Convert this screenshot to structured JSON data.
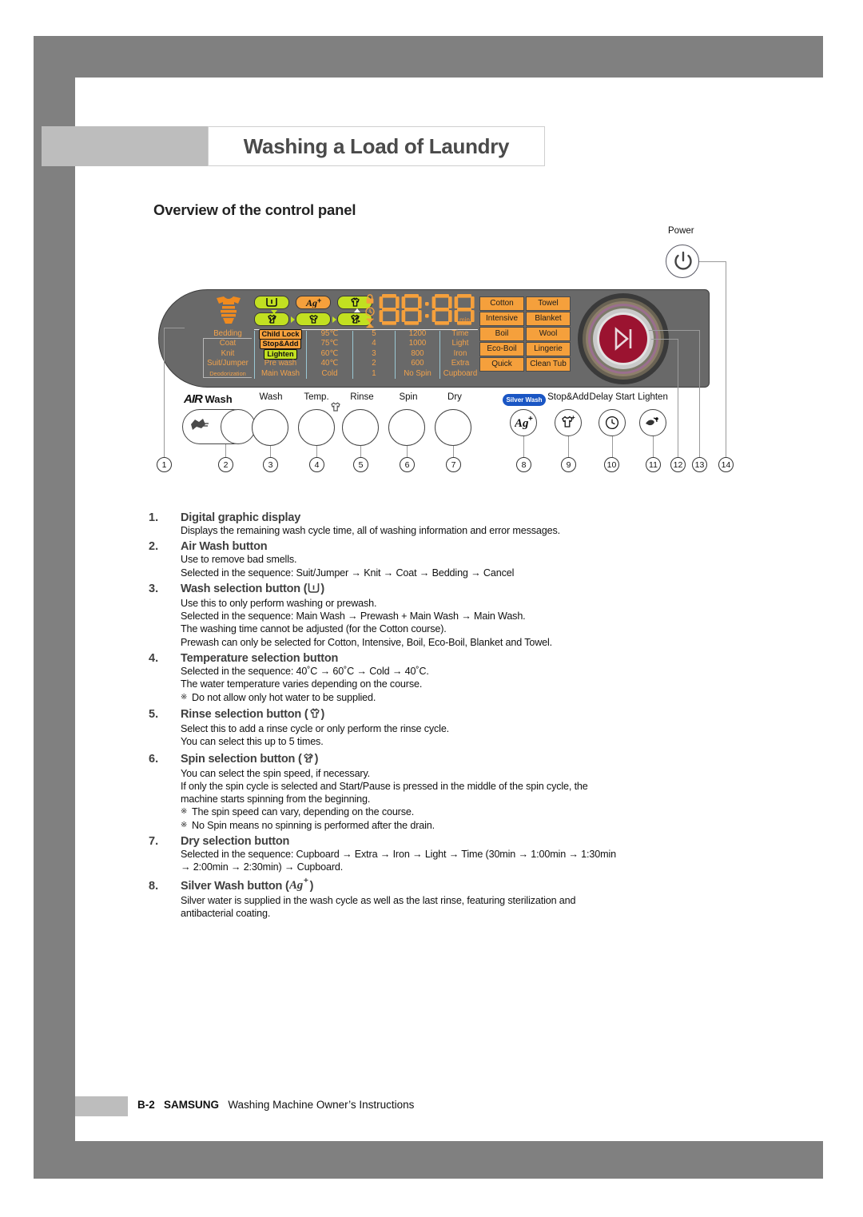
{
  "header": {
    "title": "Washing a Load of Laundry",
    "subhead": "Overview of the control panel"
  },
  "panel": {
    "power_label": "Power",
    "display_value": "88:88",
    "display_unit": "min",
    "status_icons": [
      "lock-icon",
      "clock-icon",
      "hourglass-icon"
    ],
    "mode_badges": [
      {
        "icon": "wash-tub-icon",
        "color": "#c2e021"
      },
      {
        "icon": "silver-wash-ag-icon",
        "color": "#f5a03c"
      },
      {
        "icon": "rinse-shirt-icon",
        "color": "#c2e021"
      },
      {
        "icon": "spin-shirt-icon",
        "color": "#c2e021"
      },
      {
        "icon": "dry-shirt-icon",
        "color": "#c2e021"
      },
      {
        "icon": "spin-dry-shirt-icon",
        "color": "#c2e021"
      }
    ],
    "matrix": {
      "air_wash": [
        "Bedding",
        "Coat",
        "Knit",
        "Suit/Jumper",
        "Deodorization"
      ],
      "wash": [
        "Child Lock",
        "Stop&Add",
        "Lighten",
        "Pre wash",
        "Main Wash"
      ],
      "temp": [
        "95℃",
        "75℃",
        "60℃",
        "40℃",
        "Cold"
      ],
      "rinse": [
        "5",
        "4",
        "3",
        "2",
        "1"
      ],
      "spin": [
        "1200",
        "1000",
        "800",
        "600",
        "No Spin"
      ],
      "dry": [
        "Time",
        "Light",
        "Iron",
        "Extra",
        "Cupboard"
      ]
    },
    "courses": [
      "Cotton",
      "Towel",
      "Intensive",
      "Blanket",
      "Boil",
      "Wool",
      "Eco-Boil",
      "Lingerie",
      "Quick",
      "Clean Tub"
    ],
    "buttons": [
      {
        "label": "AIR Wash",
        "num": "2"
      },
      {
        "label": "Wash",
        "num": "3"
      },
      {
        "label": "Temp.",
        "num": "4"
      },
      {
        "label": "Rinse",
        "num": "5"
      },
      {
        "label": "Spin",
        "num": "6"
      },
      {
        "label": "Dry",
        "num": "7"
      },
      {
        "label": "Silver Wash",
        "num": "8"
      },
      {
        "label": "Stop&Add",
        "num": "9"
      },
      {
        "label": "Delay Start",
        "num": "10"
      },
      {
        "label": "Lighten",
        "num": "11"
      }
    ],
    "callout_numbers": [
      "1",
      "2",
      "3",
      "4",
      "5",
      "6",
      "7",
      "8",
      "9",
      "10",
      "11",
      "12",
      "13",
      "14"
    ]
  },
  "instructions": [
    {
      "num": "1.",
      "title": "Digital graphic display",
      "glyph": "",
      "lines": [
        {
          "text": "Displays the remaining wash cycle time, all of washing information and error messages.",
          "note": false
        }
      ]
    },
    {
      "num": "2.",
      "title": "Air Wash button",
      "glyph": "",
      "lines": [
        {
          "text": "Use to remove bad smells.",
          "note": false
        },
        {
          "text": "Selected in the sequence: Suit/Jumper → Knit → Coat → Bedding → Cancel",
          "note": false
        }
      ]
    },
    {
      "num": "3.",
      "title": "Wash selection button (",
      "glyph": "wash-tub-icon",
      "title_close": ")",
      "lines": [
        {
          "text": "Use this to only perform washing or prewash.",
          "note": false
        },
        {
          "text": "Selected in the sequence: Main Wash → Prewash + Main Wash → Main Wash.",
          "note": false
        },
        {
          "text": "The washing time cannot be adjusted (for the Cotton course).",
          "note": false
        },
        {
          "text": "Prewash can only be selected for Cotton, Intensive, Boil, Eco-Boil, Blanket and Towel.",
          "note": false
        }
      ]
    },
    {
      "num": "4.",
      "title": "Temperature selection button",
      "glyph": "",
      "lines": [
        {
          "text": "Selected in the sequence: 40˚C → 60˚C → Cold → 40˚C.",
          "note": false
        },
        {
          "text": "The water temperature varies depending on the course.",
          "note": false
        },
        {
          "text": "Do not allow only hot water to be supplied.",
          "note": true
        }
      ]
    },
    {
      "num": "5.",
      "title": "Rinse selection button (",
      "glyph": "rinse-shirt-icon",
      "title_close": ")",
      "lines": [
        {
          "text": "Select this to add a rinse cycle or only perform the rinse cycle.",
          "note": false
        },
        {
          "text": "You can select this up to 5 times.",
          "note": false
        }
      ]
    },
    {
      "num": "6.",
      "title": "Spin selection button (",
      "glyph": "spin-shirt-icon",
      "title_close": ")",
      "lines": [
        {
          "text": "You can select the spin speed, if necessary.",
          "note": false
        },
        {
          "text": "If only the spin cycle is selected and Start/Pause is pressed in the middle of the spin cycle, the",
          "note": false
        },
        {
          "text": "machine starts spinning from the beginning.",
          "note": false
        },
        {
          "text": "The spin speed can vary, depending on the course.",
          "note": true
        },
        {
          "text": "No Spin means no spinning is performed after the drain.",
          "note": true
        }
      ]
    },
    {
      "num": "7.",
      "title": "Dry selection button",
      "glyph": "",
      "lines": [
        {
          "text": "Selected in the sequence: Cupboard → Extra → Iron → Light → Time (30min → 1:00min → 1:30min",
          "note": false
        },
        {
          "text": "→ 2:00min → 2:30min) → Cupboard.",
          "note": false
        }
      ]
    },
    {
      "num": "8.",
      "title": "Silver Wash button (",
      "glyph": "silver-wash-ag-icon",
      "title_close": ")",
      "lines": [
        {
          "text": "Silver water is supplied in the wash cycle as well as the last rinse, featuring sterilization and",
          "note": false
        },
        {
          "text": "antibacterial coating.",
          "note": false
        }
      ]
    }
  ],
  "footer": {
    "page": "B-2",
    "brand": "SAMSUNG",
    "doc": "Washing Machine Owner’s Instructions"
  }
}
